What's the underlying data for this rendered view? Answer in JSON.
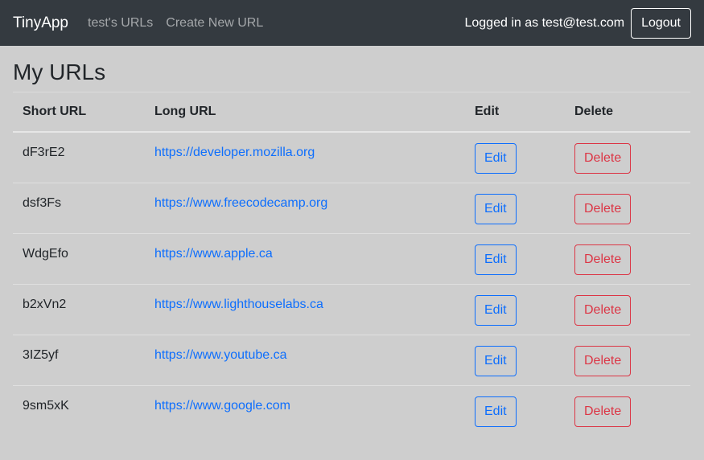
{
  "navbar": {
    "brand": "TinyApp",
    "links": [
      "test's URLs",
      "Create New URL"
    ],
    "logged_in_text": "Logged in as test@test.com",
    "logout_label": "Logout"
  },
  "page": {
    "title": "My URLs"
  },
  "table": {
    "headers": [
      "Short URL",
      "Long URL",
      "Edit",
      "Delete"
    ],
    "edit_label": "Edit",
    "delete_label": "Delete",
    "rows": [
      {
        "short": "dF3rE2",
        "long": "https://developer.mozilla.org"
      },
      {
        "short": "dsf3Fs",
        "long": "https://www.freecodecamp.org"
      },
      {
        "short": "WdgEfo",
        "long": "https://www.apple.ca"
      },
      {
        "short": "b2xVn2",
        "long": "https://www.lighthouselabs.ca"
      },
      {
        "short": "3IZ5yf",
        "long": "https://www.youtube.ca"
      },
      {
        "short": "9sm5xK",
        "long": "https://www.google.com"
      }
    ]
  },
  "colors": {
    "navbar_bg": "#343a40",
    "page_bg": "#cecece",
    "link": "#0d6efd",
    "danger": "#dc3545"
  }
}
